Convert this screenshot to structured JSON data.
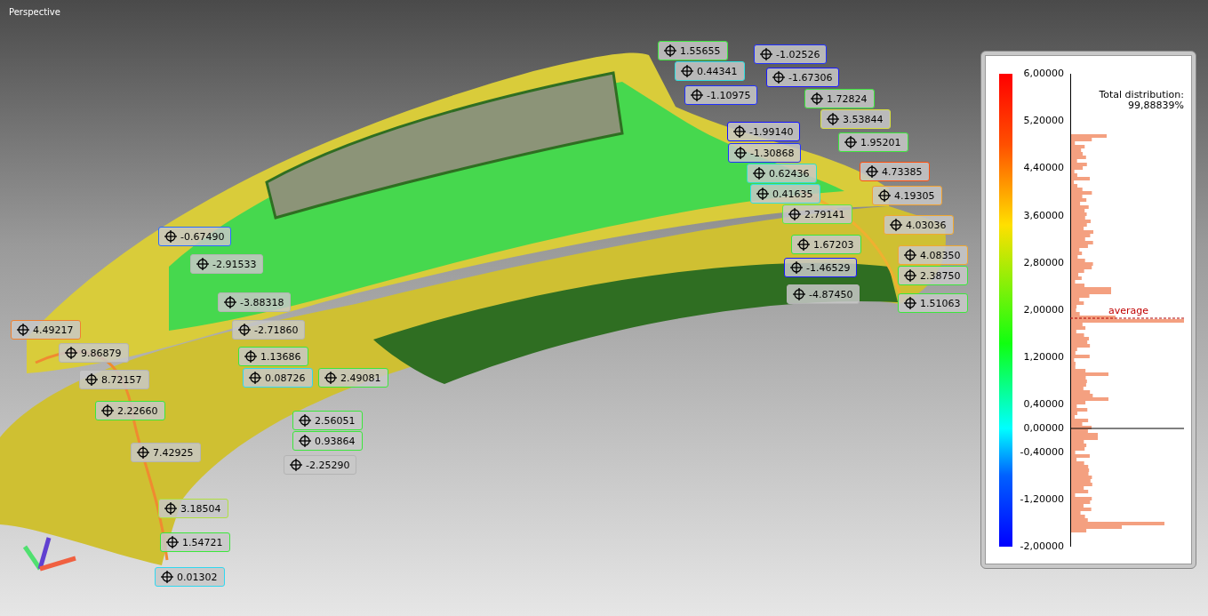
{
  "viewport": {
    "title": "Perspective"
  },
  "labels": [
    {
      "value": "1.55655",
      "color": "#3ce63c"
    },
    {
      "value": "0.44341",
      "color": "#30e0e0"
    },
    {
      "value": "-1.02526",
      "color": "#2030ff"
    },
    {
      "value": "-1.67306",
      "color": "#1818ff"
    },
    {
      "value": "-1.10975",
      "color": "#2030ff"
    },
    {
      "value": "1.72824",
      "color": "#3ce63c"
    },
    {
      "value": "3.53844",
      "color": "#d8e040"
    },
    {
      "value": "-1.99140",
      "color": "#1010ff"
    },
    {
      "value": "1.95201",
      "color": "#3ce63c"
    },
    {
      "value": "-1.30868",
      "color": "#2030ff"
    },
    {
      "value": "0.62436",
      "color": "#30e0c0"
    },
    {
      "value": "4.73385",
      "color": "#ff5010"
    },
    {
      "value": "2.79141",
      "color": "#60e840"
    },
    {
      "value": "0.41635",
      "color": "#30e0e0"
    },
    {
      "value": "4.19305",
      "color": "#f0a030"
    },
    {
      "value": "4.03036",
      "color": "#f0a830"
    },
    {
      "value": "1.67203",
      "color": "#3ce63c"
    },
    {
      "value": "4.08350",
      "color": "#f0a830"
    },
    {
      "value": "-1.46529",
      "color": "#1818ff"
    },
    {
      "value": "2.38750",
      "color": "#3ce63c"
    },
    {
      "value": "-4.87450",
      "color": "#b4b4b4"
    },
    {
      "value": "1.51063",
      "color": "#3ce63c"
    },
    {
      "value": "-0.67490",
      "color": "#2a6cff"
    },
    {
      "value": "-2.91533",
      "color": "#b4b4b4"
    },
    {
      "value": "-3.88318",
      "color": "#b4b4b4"
    },
    {
      "value": "-2.71860",
      "color": "#b4b4b4"
    },
    {
      "value": "4.49217",
      "color": "#f08030"
    },
    {
      "value": "9.86879",
      "color": "#b4b4b4"
    },
    {
      "value": "1.13686",
      "color": "#3ce63c"
    },
    {
      "value": "8.72157",
      "color": "#b4b4b4"
    },
    {
      "value": "0.08726",
      "color": "#30d8f0"
    },
    {
      "value": "2.49081",
      "color": "#3ce63c"
    },
    {
      "value": "2.22660",
      "color": "#3ce63c"
    },
    {
      "value": "2.56051",
      "color": "#3ce63c"
    },
    {
      "value": "0.93864",
      "color": "#3ce63c"
    },
    {
      "value": "7.42925",
      "color": "#b4b4b4"
    },
    {
      "value": "-2.25290",
      "color": "#b4b4b4"
    },
    {
      "value": "3.18504",
      "color": "#b0e040"
    },
    {
      "value": "1.54721",
      "color": "#3ce63c"
    },
    {
      "value": "0.01302",
      "color": "#30d8f0"
    }
  ],
  "legend": {
    "ticks": [
      "6,00000",
      "5,20000",
      "4,40000",
      "3,60000",
      "2,80000",
      "2,00000",
      "1,20000",
      "0,40000",
      "0,00000",
      "-0,40000",
      "-1,20000",
      "-2,00000"
    ],
    "total_label": "Total distribution:",
    "total_value": "99,88839%",
    "average_label": "average"
  }
}
